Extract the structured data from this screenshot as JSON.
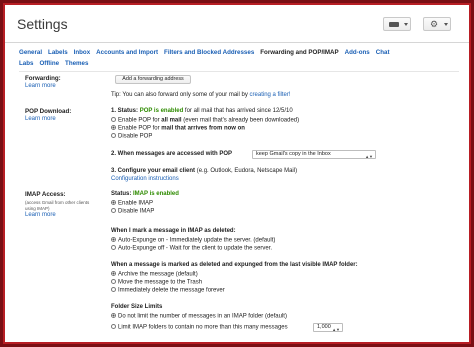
{
  "header": {
    "title": "Settings"
  },
  "tabs": [
    "General",
    "Labels",
    "Inbox",
    "Accounts and Import",
    "Filters and Blocked Addresses",
    "Forwarding and POP/IMAP",
    "Add-ons",
    "Chat",
    "Labs",
    "Offline",
    "Themes"
  ],
  "forwarding": {
    "label": "Forwarding:",
    "learn_more": "Learn more",
    "add_button": "Add a forwarding address",
    "tip_prefix": "Tip: You can also forward only some of your mail by ",
    "tip_link": "creating a filter!"
  },
  "pop": {
    "label": "POP Download:",
    "learn_more": "Learn more",
    "status_prefix": "1. Status: ",
    "status_value": "POP is enabled",
    "status_suffix": " for all mail that has arrived since 12/5/10",
    "opt1_pre": "Enable POP for ",
    "opt1_b": "all mail",
    "opt1_post": " (even mail that's already been downloaded)",
    "opt2_pre": "Enable POP for ",
    "opt2_b": "mail that arrives from now on",
    "opt3": "Disable POP",
    "step2": "2. When messages are accessed with POP",
    "step2_select": "keep Gmail's copy in the Inbox",
    "step3": "3. Configure your email client",
    "step3_suffix": " (e.g. Outlook, Eudora, Netscape Mail)",
    "config_link": "Configuration instructions"
  },
  "imap": {
    "label": "IMAP Access:",
    "desc1": "(access Gmail from other clients",
    "desc2": "using IMAP)",
    "learn_more": "Learn more",
    "status_prefix": "Status: ",
    "status_value": "IMAP is enabled",
    "enable": "Enable IMAP",
    "disable": "Disable IMAP",
    "deleted_heading": "When I mark a message in IMAP as deleted:",
    "expunge_on": "Auto-Expunge on - Immediately update the server. (default)",
    "expunge_off": "Auto-Expunge off - Wait for the client to update the server.",
    "expunged_heading": "When a message is marked as deleted and expunged from the last visible IMAP folder:",
    "archive": "Archive the message (default)",
    "trash": "Move the message to the Trash",
    "delete_forever": "Immediately delete the message forever",
    "folder_heading": "Folder Size Limits",
    "no_limit": "Do not limit the number of messages in an IMAP folder (default)",
    "limit": "Limit IMAP folders to contain no more than this many messages",
    "limit_value": "1,000"
  }
}
